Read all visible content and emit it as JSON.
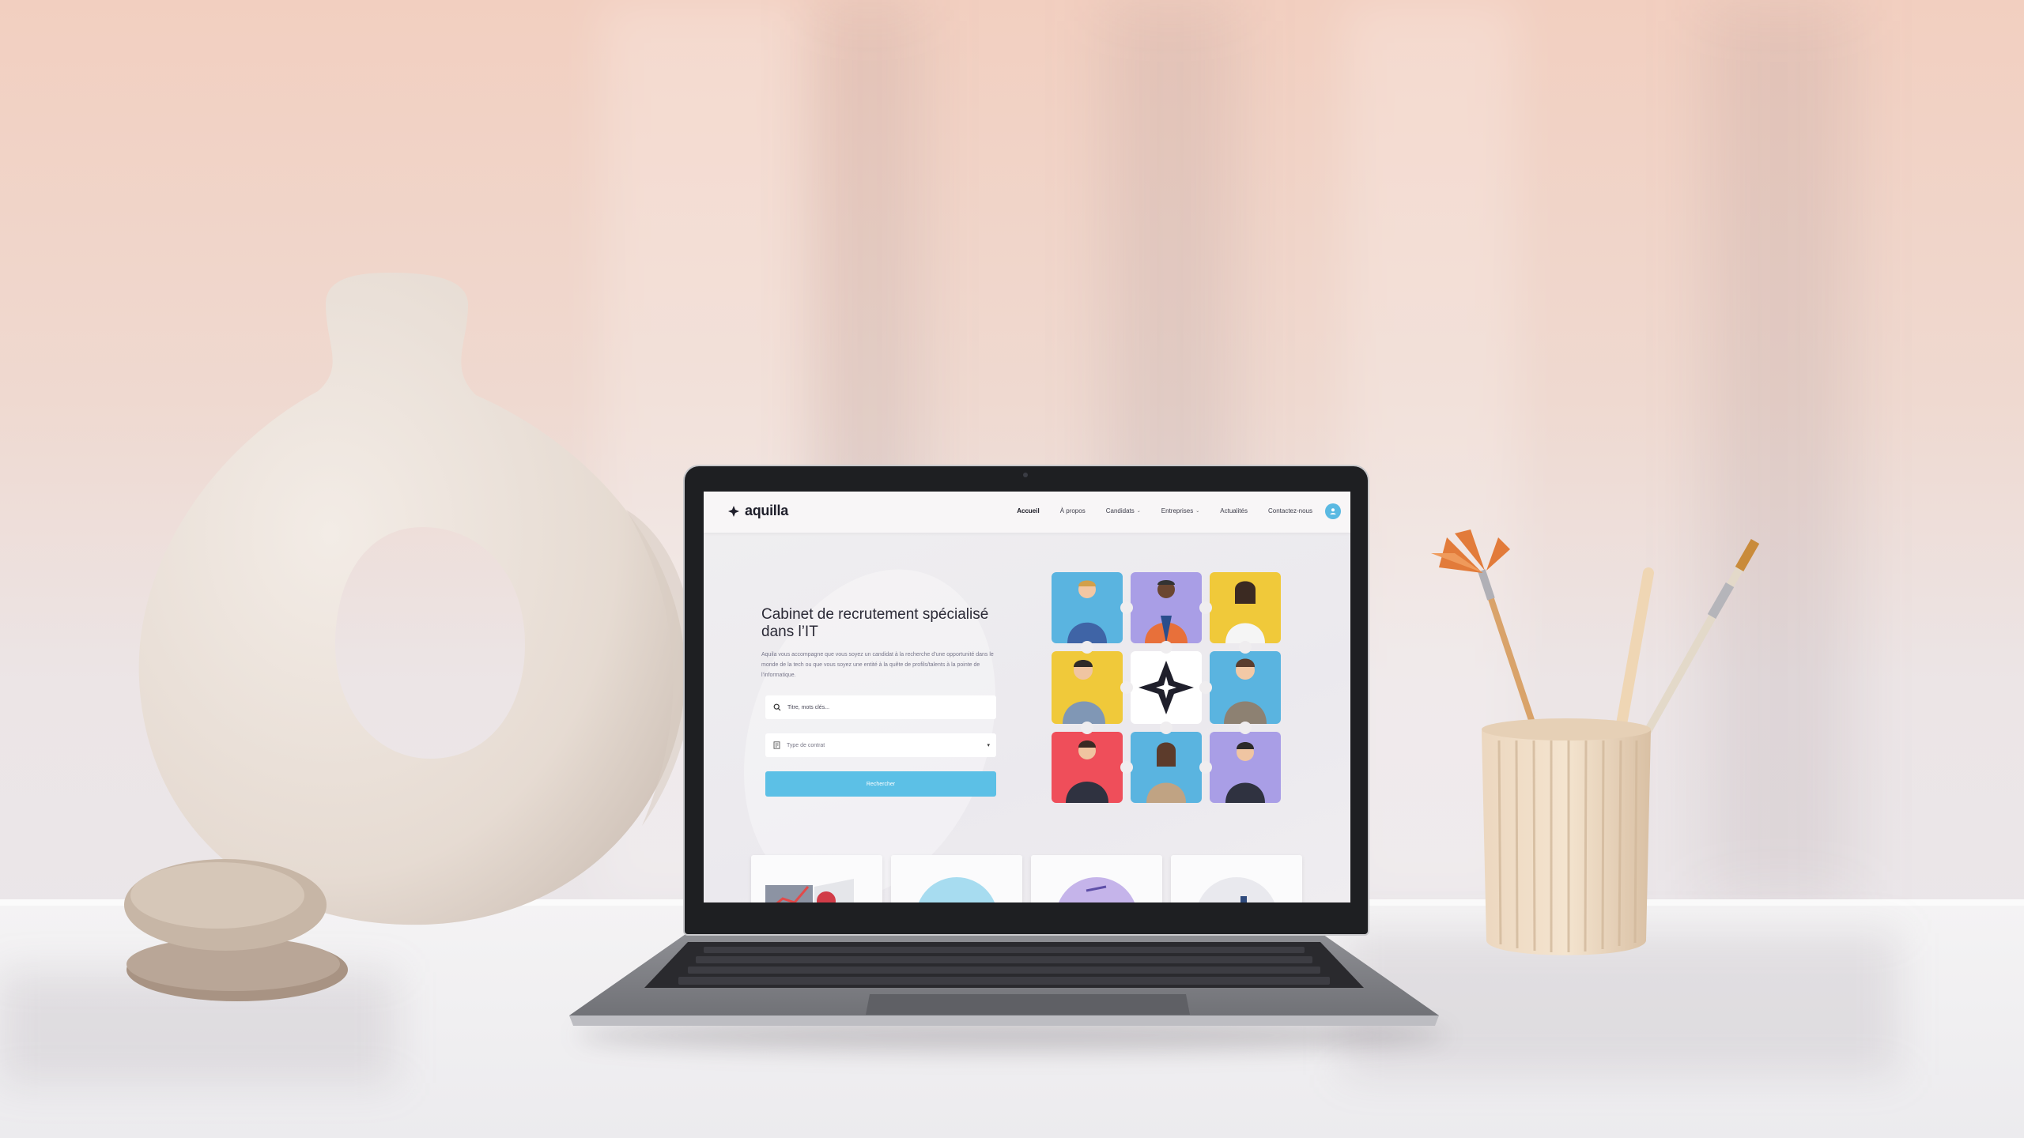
{
  "site": {
    "logo_text": "aquilla",
    "nav": [
      {
        "label": "Accueil",
        "active": true,
        "dropdown": false
      },
      {
        "label": "À propos",
        "active": false,
        "dropdown": false
      },
      {
        "label": "Candidats",
        "active": false,
        "dropdown": true
      },
      {
        "label": "Entreprises",
        "active": false,
        "dropdown": true
      },
      {
        "label": "Actualités",
        "active": false,
        "dropdown": false
      },
      {
        "label": "Contactez-nous",
        "active": false,
        "dropdown": false
      }
    ],
    "user_icon": "user-icon"
  },
  "hero": {
    "title": "Cabinet de recrutement spécialisé dans l’IT",
    "description": "Aquila vous accompagne que vous soyez un candidat à la recherche d’une opportunité dans le monde de la tech ou que vous soyez une entité à la quête de profils/talents à la pointe de l’informatique.",
    "search_placeholder": "Titre, mots clés...",
    "select_placeholder": "Type de contrat",
    "search_button": "Rechercher"
  },
  "colors": {
    "accent": "#5cc0e6",
    "puzzle": [
      "#5ab4e0",
      "#a99ee6",
      "#f0c93a",
      "#f0c93a",
      "#ffffff",
      "#5ab4e0",
      "#ef4e5a",
      "#5ab4e0",
      "#a99ee6"
    ]
  }
}
